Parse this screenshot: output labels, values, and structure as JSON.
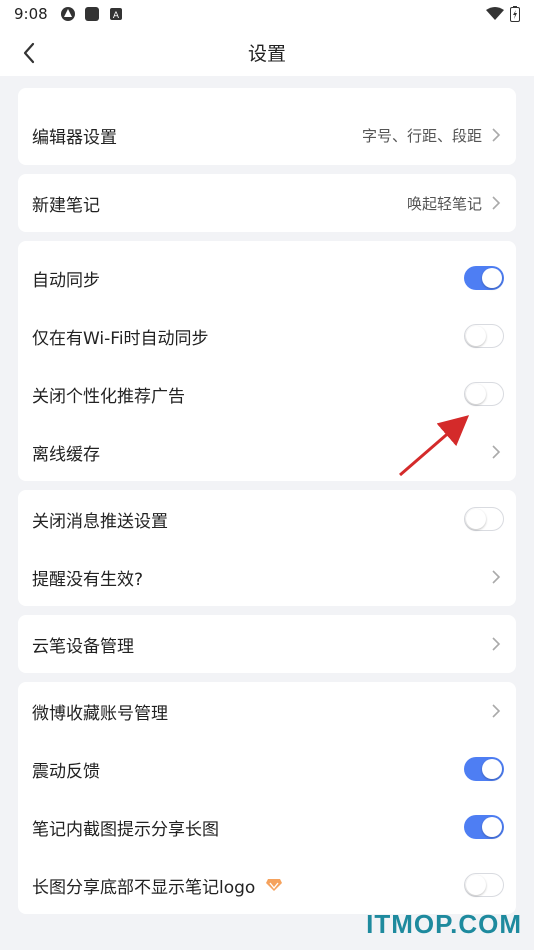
{
  "status_bar": {
    "time": "9:08",
    "left_icons": [
      "vpn-icon",
      "square-notification-icon",
      "a-box-notification-icon"
    ],
    "right_icons": [
      "wifi-icon",
      "battery-icon"
    ]
  },
  "header": {
    "title": "设置",
    "back_icon": "back-arrow-icon"
  },
  "sections": {
    "editor": {
      "label": "编辑器设置",
      "value": "字号、行距、段距"
    },
    "new_note": {
      "label": "新建笔记",
      "value": "唤起轻笔记"
    },
    "sync": {
      "auto_sync": {
        "label": "自动同步",
        "on": true
      },
      "wifi_sync": {
        "label": "仅在有Wi-Fi时自动同步",
        "on": false
      },
      "ads": {
        "label": "关闭个性化推荐广告",
        "on": false
      },
      "offline": {
        "label": "离线缓存"
      }
    },
    "notify": {
      "push": {
        "label": "关闭消息推送设置",
        "on": false
      },
      "reminder": {
        "label": "提醒没有生效?"
      }
    },
    "device": {
      "label": "云笔设备管理"
    },
    "misc": {
      "weibo": {
        "label": "微博收藏账号管理"
      },
      "vibrate": {
        "label": "震动反馈",
        "on": true
      },
      "screenshot": {
        "label": "笔记内截图提示分享长图",
        "on": true
      },
      "logo": {
        "label": "长图分享底部不显示笔记logo",
        "on": false,
        "badge_icon": "vip-diamond-icon"
      }
    }
  },
  "colors": {
    "accent": "#4e7ef3",
    "background": "#f2f3f6",
    "annotation_arrow": "#d42a2a",
    "vip_badge": "#f5a25d"
  },
  "watermark": "ITMOP.COM"
}
